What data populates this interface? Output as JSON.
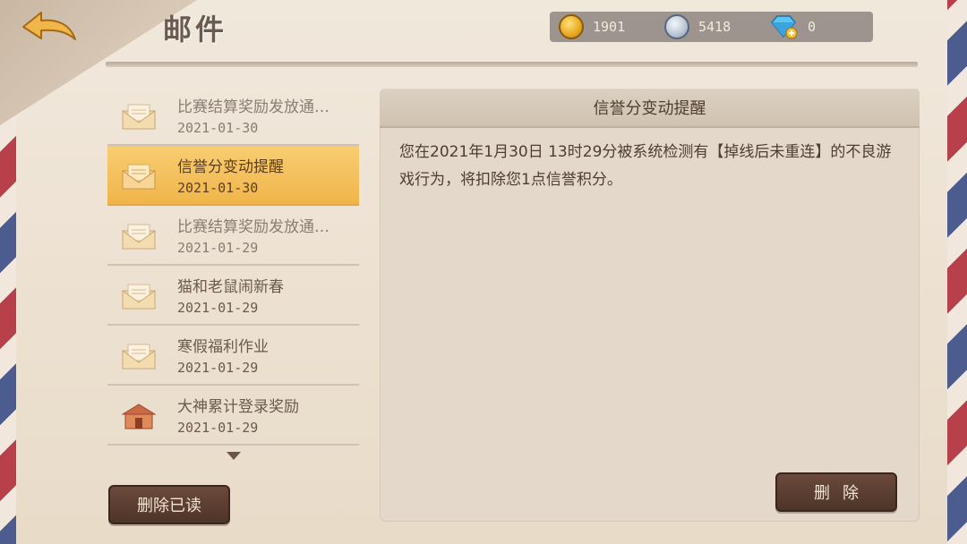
{
  "header": {
    "title": "邮件",
    "currencies": [
      {
        "icon": "gold-coin-icon",
        "value": "1901"
      },
      {
        "icon": "silver-coin-icon",
        "value": "5418"
      },
      {
        "icon": "diamond-icon",
        "value": "0"
      }
    ]
  },
  "mail_list": [
    {
      "subject": "比赛结算奖励发放通…",
      "date": "2021-01-30",
      "icon": "envelope-icon",
      "selected": false,
      "read": true
    },
    {
      "subject": "信誉分变动提醒",
      "date": "2021-01-30",
      "icon": "envelope-icon",
      "selected": true,
      "read": false
    },
    {
      "subject": "比赛结算奖励发放通…",
      "date": "2021-01-29",
      "icon": "envelope-icon",
      "selected": false,
      "read": true
    },
    {
      "subject": "猫和老鼠闹新春",
      "date": "2021-01-29",
      "icon": "envelope-icon",
      "selected": false,
      "read": false
    },
    {
      "subject": "寒假福利作业",
      "date": "2021-01-29",
      "icon": "envelope-icon",
      "selected": false,
      "read": false
    },
    {
      "subject": "大神累计登录奖励",
      "date": "2021-01-29",
      "icon": "house-icon",
      "selected": false,
      "read": false
    }
  ],
  "buttons": {
    "delete_read": "删除已读",
    "delete": "删除"
  },
  "mail_detail": {
    "title": "信誉分变动提醒",
    "body": "您在2021年1月30日 13时29分被系统检测有【掉线后未重连】的不良游戏行为，将扣除您1点信誉积分。"
  },
  "colors": {
    "selected_item": "#f0b54a",
    "button_bg": "#5c3f31",
    "title_text": "#6a5a50"
  }
}
